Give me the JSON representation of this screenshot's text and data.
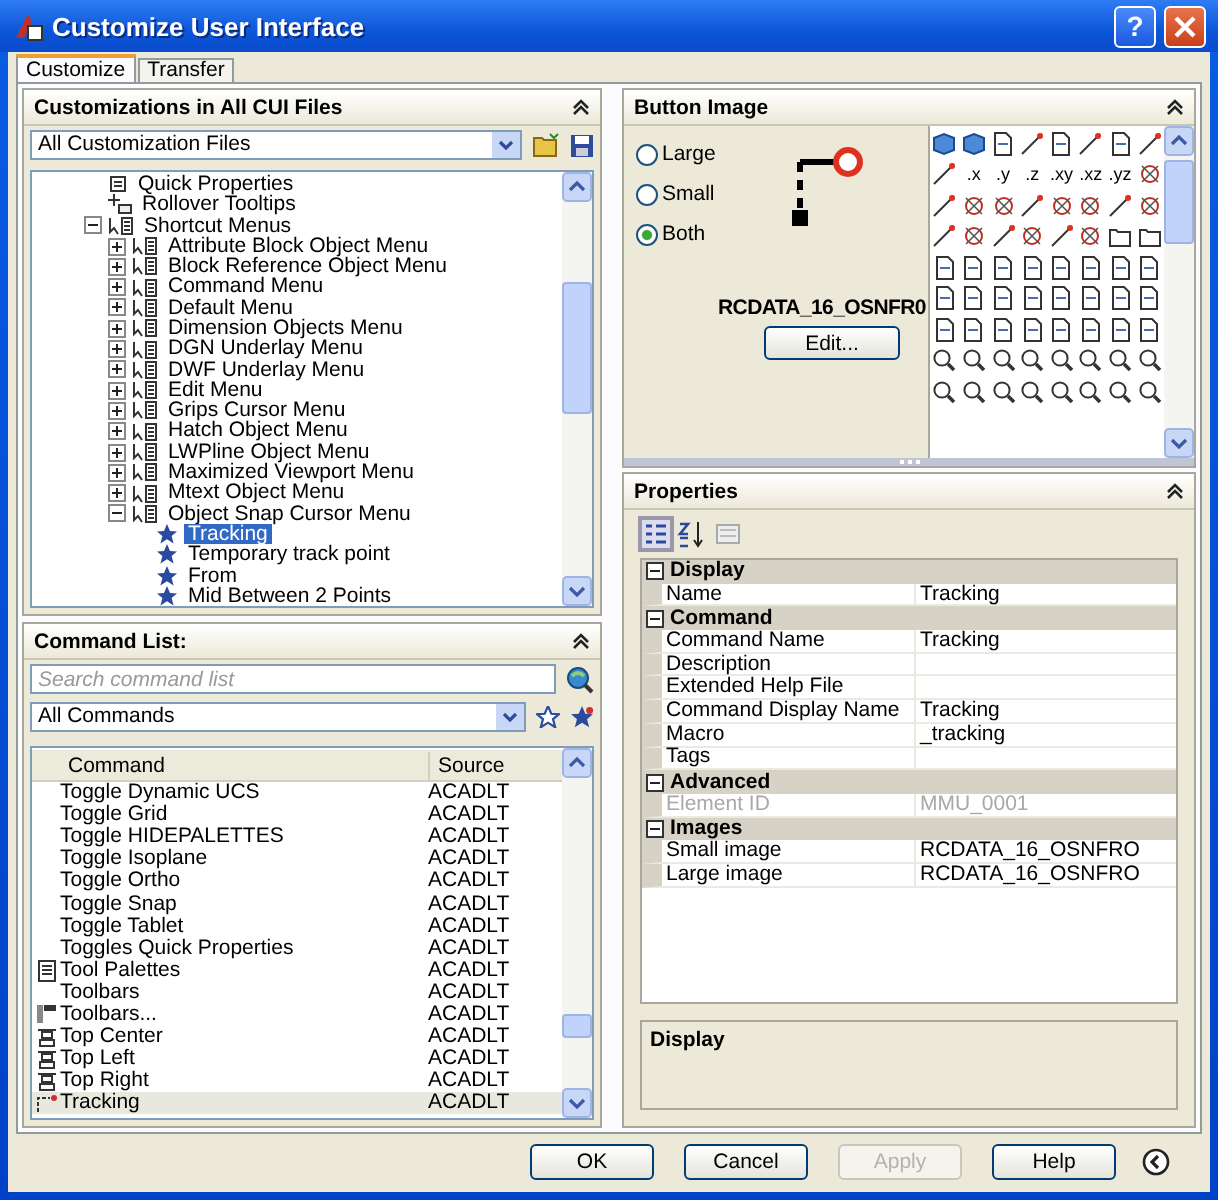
{
  "window": {
    "title": "Customize User Interface",
    "help_button": "?"
  },
  "tabs": [
    {
      "label": "Customize",
      "selected": true
    },
    {
      "label": "Transfer",
      "selected": false
    }
  ],
  "customizations": {
    "title": "Customizations in All CUI Files",
    "dropdown": "All Customization Files",
    "tree": [
      {
        "label": "Quick Properties",
        "kind": "properties"
      },
      {
        "label": "Rollover Tooltips",
        "kind": "tooltips"
      },
      {
        "label": "Shortcut Menus",
        "kind": "menu",
        "expanded": true,
        "children": [
          {
            "label": "Attribute Block Object Menu",
            "kind": "menu",
            "expanded": false
          },
          {
            "label": "Block Reference Object Menu",
            "kind": "menu",
            "expanded": false
          },
          {
            "label": "Command Menu",
            "kind": "menu",
            "expanded": false
          },
          {
            "label": "Default Menu",
            "kind": "menu",
            "expanded": false
          },
          {
            "label": "Dimension Objects Menu",
            "kind": "menu",
            "expanded": false
          },
          {
            "label": "DGN Underlay Menu",
            "kind": "menu",
            "expanded": false
          },
          {
            "label": "DWF Underlay Menu",
            "kind": "menu",
            "expanded": false
          },
          {
            "label": "Edit Menu",
            "kind": "menu",
            "expanded": false
          },
          {
            "label": "Grips Cursor Menu",
            "kind": "menu",
            "expanded": false
          },
          {
            "label": "Hatch Object Menu",
            "kind": "menu",
            "expanded": false
          },
          {
            "label": "LWPline Object Menu",
            "kind": "menu",
            "expanded": false
          },
          {
            "label": "Maximized Viewport Menu",
            "kind": "menu",
            "expanded": false
          },
          {
            "label": "Mtext Object Menu",
            "kind": "menu",
            "expanded": false
          },
          {
            "label": "Object Snap Cursor Menu",
            "kind": "menu",
            "expanded": true,
            "children": [
              {
                "label": "Tracking",
                "kind": "command",
                "selected": true
              },
              {
                "label": "Temporary track point",
                "kind": "command",
                "selected": false
              },
              {
                "label": "From",
                "kind": "command",
                "selected": false
              },
              {
                "label": "Mid Between 2 Points",
                "kind": "command",
                "selected": false
              }
            ]
          }
        ]
      }
    ]
  },
  "command_list": {
    "title": "Command List:",
    "search": {
      "placeholder": "Search command list"
    },
    "filter": "All Commands",
    "columns": [
      "Command",
      "Source"
    ],
    "rows": [
      {
        "command": "Toggle Dynamic UCS",
        "source": "ACADLT",
        "kind": "plain",
        "selected": false
      },
      {
        "command": "Toggle Grid",
        "source": "ACADLT",
        "kind": "plain",
        "selected": false
      },
      {
        "command": "Toggle HIDEPALETTES",
        "source": "ACADLT",
        "kind": "plain",
        "selected": false
      },
      {
        "command": "Toggle Isoplane",
        "source": "ACADLT",
        "kind": "plain",
        "selected": false
      },
      {
        "command": "Toggle Ortho",
        "source": "ACADLT",
        "kind": "plain",
        "selected": false
      },
      {
        "command": "Toggle Snap",
        "source": "ACADLT",
        "kind": "plain",
        "selected": false
      },
      {
        "command": "Toggle Tablet",
        "source": "ACADLT",
        "kind": "plain",
        "selected": false
      },
      {
        "command": "Toggles Quick Properties",
        "source": "ACADLT",
        "kind": "plain",
        "selected": false
      },
      {
        "command": "Tool Palettes",
        "source": "ACADLT",
        "kind": "palette",
        "selected": false
      },
      {
        "command": "Toolbars",
        "source": "ACADLT",
        "kind": "plain",
        "selected": false
      },
      {
        "command": "Toolbars...",
        "source": "ACADLT",
        "kind": "toolbar",
        "selected": false
      },
      {
        "command": "Top Center",
        "source": "ACADLT",
        "kind": "align",
        "selected": false
      },
      {
        "command": "Top Left",
        "source": "ACADLT",
        "kind": "align",
        "selected": false
      },
      {
        "command": "Top Right",
        "source": "ACADLT",
        "kind": "align",
        "selected": false
      },
      {
        "command": "Tracking",
        "source": "ACADLT",
        "kind": "tracking",
        "selected": true
      }
    ]
  },
  "button_image": {
    "title": "Button Image",
    "sizes": [
      {
        "label": "Large",
        "selected": false
      },
      {
        "label": "Small",
        "selected": false
      },
      {
        "label": "Both",
        "selected": true
      }
    ],
    "image_name": "RCDATA_16_OSNFR0",
    "edit_button": "Edit...",
    "grid_labels": [
      ".x",
      ".y",
      ".z",
      ".xy",
      ".xz",
      ".yz"
    ]
  },
  "properties": {
    "title": "Properties",
    "categories": [
      {
        "name": "Display",
        "rows": [
          {
            "name": "Name",
            "value": "Tracking",
            "disabled": false
          }
        ]
      },
      {
        "name": "Command",
        "rows": [
          {
            "name": "Command Name",
            "value": "Tracking",
            "disabled": false
          },
          {
            "name": "Description",
            "disabled": false
          },
          {
            "name": "Extended Help File",
            "disabled": false
          },
          {
            "name": "Command Display Name",
            "value": "Tracking",
            "disabled": false
          },
          {
            "name": "Macro",
            "value": "_tracking",
            "disabled": false
          },
          {
            "name": "Tags",
            "disabled": false
          }
        ]
      },
      {
        "name": "Advanced",
        "rows": [
          {
            "name": "Element ID",
            "value": "MMU_0001",
            "disabled": true
          }
        ]
      },
      {
        "name": "Images",
        "rows": [
          {
            "name": "Small image",
            "value": "RCDATA_16_OSNFRO",
            "disabled": false
          },
          {
            "name": "Large image",
            "value": "RCDATA_16_OSNFRO",
            "disabled": false
          }
        ]
      }
    ],
    "description": "Display"
  },
  "buttons": [
    {
      "label": "OK",
      "disabled": false
    },
    {
      "label": "Cancel",
      "disabled": false
    },
    {
      "label": "Apply",
      "disabled": true
    },
    {
      "label": "Help",
      "disabled": false
    }
  ]
}
